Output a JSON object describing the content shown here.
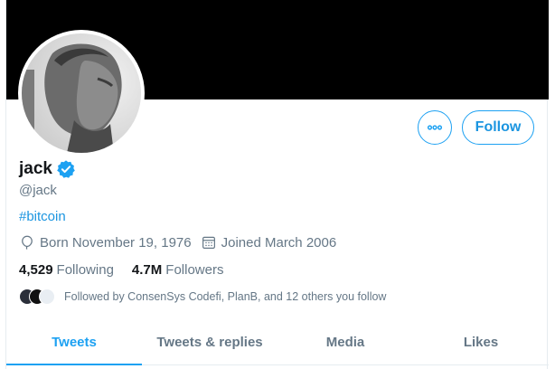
{
  "profile": {
    "name": "jack",
    "handle": "@jack",
    "bio": "#bitcoin",
    "born": "Born November 19, 1976",
    "joined": "Joined March 2006",
    "following_count": "4,529",
    "following_label": "Following",
    "followers_count": "4.7M",
    "followers_label": "Followers",
    "followed_by": "Followed by ConsenSys Codefi, PlanB, and 12 others you follow"
  },
  "actions": {
    "follow_label": "Follow"
  },
  "tabs": [
    {
      "label": "Tweets",
      "active": true
    },
    {
      "label": "Tweets & replies",
      "active": false
    },
    {
      "label": "Media",
      "active": false
    },
    {
      "label": "Likes",
      "active": false
    }
  ],
  "colors": {
    "accent": "#1da1f2",
    "banner": "#000000",
    "secondary_text": "#657786"
  },
  "icons": {
    "more": "more-horizontal-icon",
    "verified": "verified-badge-icon",
    "birthday": "balloon-icon",
    "joined": "calendar-icon"
  }
}
